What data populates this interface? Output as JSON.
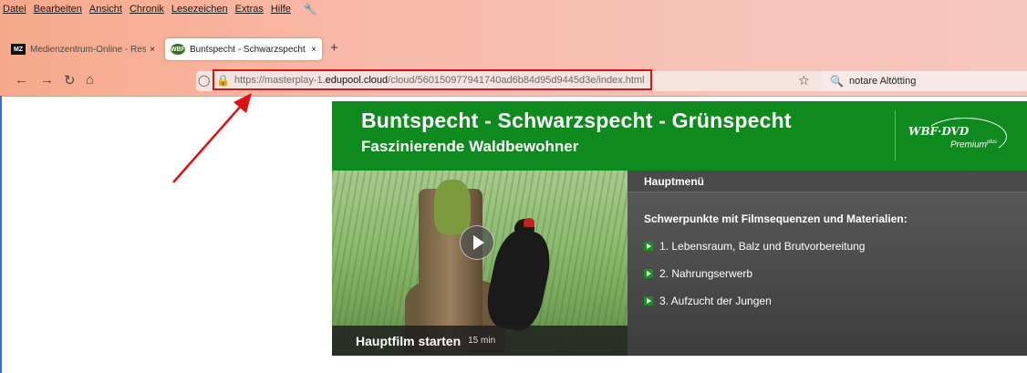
{
  "menubar": {
    "items": [
      "Datei",
      "Bearbeiten",
      "Ansicht",
      "Chronik",
      "Lesezeichen",
      "Extras",
      "Hilfe"
    ]
  },
  "tabs": [
    {
      "favicon": "MZ",
      "title": "Medienzentrum-Online - Result",
      "close": "×"
    },
    {
      "favicon": "WBF",
      "title": "Buntspecht - Schwarzspecht - G",
      "close": "×"
    }
  ],
  "newtab_label": "+",
  "nav": {
    "url_protocol": "https://masterplay-1.",
    "url_domain": "edupool.cloud",
    "url_path": "/cloud/560150977941740ad6b84d95d9445d3e/index.html",
    "search_value": "notare Altötting"
  },
  "player": {
    "title": "Buntspecht - Schwarzspecht - Grünspecht",
    "subtitle": "Faszinierende Waldbewohner",
    "logo_main": "WBF·DVD",
    "logo_sub": "Premium",
    "logo_sup": "plus",
    "video_caption": "Hauptfilm starten",
    "video_duration": "15 min",
    "menu_title": "Hauptmenü",
    "menu_subtitle": "Schwerpunkte mit Filmsequenzen und Materialien:",
    "menu_items": [
      "1. Lebensraum, Balz und Brutvorbereitung",
      "2. Nahrungserwerb",
      "3. Aufzucht der Jungen"
    ]
  },
  "colors": {
    "banner_green": "#0f8a1e",
    "annotation_red": "#e01010"
  }
}
